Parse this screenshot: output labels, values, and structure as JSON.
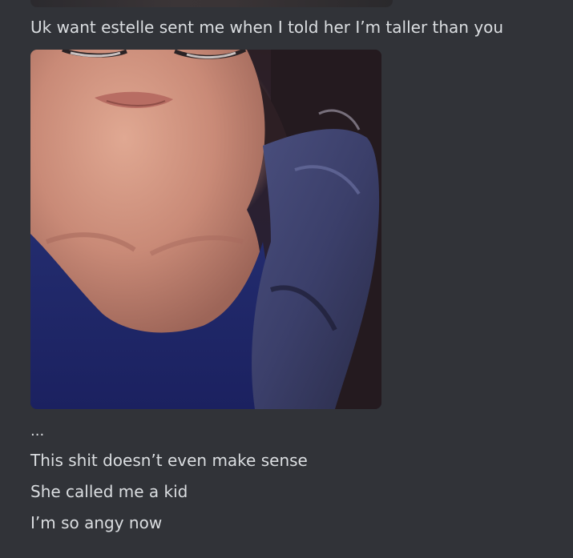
{
  "messages": [
    {
      "text": "Uk want estelle sent me when I told her I’m taller than you"
    },
    {
      "text": "..."
    },
    {
      "text": "This shit doesn’t even make sense"
    },
    {
      "text": "She called me a kid"
    },
    {
      "text": "I’m so angy now"
    }
  ],
  "colors": {
    "background": "#313338",
    "message_text": "#dbdee1"
  }
}
